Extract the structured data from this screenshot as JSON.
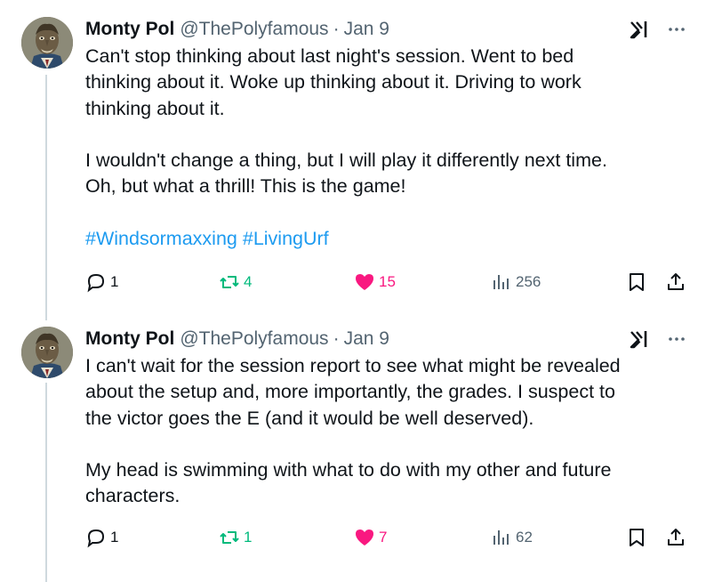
{
  "tweets": [
    {
      "author_name": "Monty Pol",
      "handle": "@ThePolyfamous",
      "separator": "·",
      "date": "Jan 9",
      "text_p1": "Can't stop thinking about last night's session. Went to bed\nthinking about it. Woke up thinking about it. Driving to work\nthinking about it.",
      "text_p2": "I wouldn't change a thing, but I will play it differently next time.\nOh, but what a thrill! This is the game!",
      "hashtags": [
        "#Windsormaxxing",
        "#LivingUrf"
      ],
      "reply_count": "1",
      "retweet_count": "4",
      "like_count": "15",
      "view_count": "256"
    },
    {
      "author_name": "Monty Pol",
      "handle": "@ThePolyfamous",
      "separator": "·",
      "date": "Jan 9",
      "text_p1": "I can't wait for the session report to see what might be revealed\nabout the setup and, more importantly, the grades. I suspect to\nthe victor goes the E (and it would be well deserved).",
      "text_p2": "My head is swimming with what to do with my other and future\ncharacters.",
      "reply_count": "1",
      "retweet_count": "1",
      "like_count": "7",
      "view_count": "62"
    }
  ],
  "colors": {
    "text": "#0f1419",
    "muted": "#536471",
    "hashtag": "#1d9bf0",
    "retweet": "#00ba7c",
    "like": "#f91880",
    "thread_line": "#cfd9de"
  },
  "icons": [
    "grok-icon",
    "more-icon",
    "reply-icon",
    "retweet-icon",
    "heart-icon",
    "views-icon",
    "bookmark-icon",
    "share-icon"
  ]
}
